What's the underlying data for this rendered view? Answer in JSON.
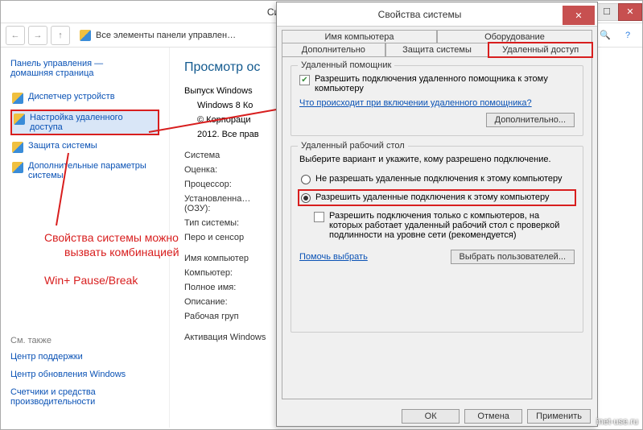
{
  "window": {
    "title": "Система",
    "breadcrumb": "Все элементы панели управлен…",
    "search_placeholder": ""
  },
  "sidebar": {
    "top_line1": "Панель управления —",
    "top_line2": "домашняя страница",
    "items": [
      {
        "label": "Диспетчер устройств"
      },
      {
        "label": "Настройка удаленного доступа"
      },
      {
        "label": "Защита системы"
      },
      {
        "label": "Дополнительные параметры системы"
      }
    ],
    "see_also": "См. также",
    "bottom": [
      "Центр поддержки",
      "Центр обновления Windows",
      "Счетчики и средства производительности"
    ]
  },
  "main": {
    "heading": "Просмотр ос",
    "edition_label": "Выпуск Windows",
    "edition_val": "Windows 8 Ко",
    "copyright1": "© Корпораци",
    "copyright2": "2012. Все прав",
    "system_head": "Система",
    "rows": [
      {
        "label": "Оценка:"
      },
      {
        "label": "Процессор:"
      },
      {
        "label": "Установленна… (ОЗУ):"
      },
      {
        "label": "Тип системы:"
      },
      {
        "label": "Перо и сенсор"
      }
    ],
    "comp_head": "Имя компьютер",
    "comp_rows": [
      {
        "label": "Компьютер:"
      },
      {
        "label": "Полное имя:"
      },
      {
        "label": "Описание:"
      },
      {
        "label": "Рабочая груп"
      }
    ],
    "activation": "Активация Windows"
  },
  "annotation": {
    "line1": "Свойства системы можно",
    "line2": "вызвать комбинацией",
    "line3": "Win+ Pause/Break"
  },
  "dialog": {
    "title": "Свойства системы",
    "tabs_top": [
      "Имя компьютера",
      "Оборудование"
    ],
    "tabs_bottom": [
      "Дополнительно",
      "Защита системы",
      "Удаленный доступ"
    ],
    "group1": {
      "title": "Удаленный помощник",
      "chk_label": "Разрешить подключения удаленного помощника к этому компьютеру",
      "link": "Что происходит при включении удаленного помощника?",
      "btn": "Дополнительно..."
    },
    "group2": {
      "title": "Удаленный рабочий стол",
      "intro": "Выберите вариант и укажите, кому разрешено подключение.",
      "radio1": "Не разрешать удаленные подключения к этому компьютеру",
      "radio2": "Разрешить удаленные подключения к этому компьютеру",
      "chk2": "Разрешить подключения только с компьютеров, на которых работает удаленный рабочий стол с проверкой подлинности на уровне сети (рекомендуется)",
      "help_link": "Помочь выбрать",
      "users_btn": "Выбрать пользователей..."
    },
    "buttons": {
      "ok": "ОК",
      "cancel": "Отмена",
      "apply": "Применить"
    }
  },
  "watermark": "inet-use.ru"
}
